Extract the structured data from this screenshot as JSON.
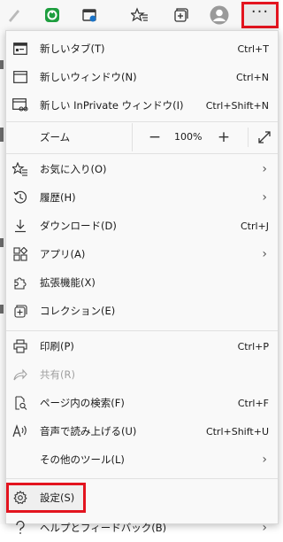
{
  "toolbar": {
    "icons": [
      "pen-icon",
      "extension-green-icon",
      "screen-capture-icon",
      "favorites-icon",
      "collections-icon",
      "profile-avatar-icon",
      "more-icon"
    ],
    "more_label": "···"
  },
  "menu": {
    "new_tab": {
      "label": "新しいタブ(T)",
      "shortcut": "Ctrl+T"
    },
    "new_window": {
      "label": "新しいウィンドウ(N)",
      "shortcut": "Ctrl+N"
    },
    "new_inprivate": {
      "label": "新しい InPrivate ウィンドウ(I)",
      "shortcut": "Ctrl+Shift+N"
    },
    "zoom": {
      "label": "ズーム",
      "minus": "−",
      "value": "100%",
      "plus": "+"
    },
    "favorites": {
      "label": "お気に入り(O)"
    },
    "history": {
      "label": "履歴(H)"
    },
    "downloads": {
      "label": "ダウンロード(D)",
      "shortcut": "Ctrl+J"
    },
    "apps": {
      "label": "アプリ(A)"
    },
    "extensions": {
      "label": "拡張機能(X)"
    },
    "collections": {
      "label": "コレクション(E)"
    },
    "print": {
      "label": "印刷(P)",
      "shortcut": "Ctrl+P"
    },
    "share": {
      "label": "共有(R)"
    },
    "find": {
      "label": "ページ内の検索(F)",
      "shortcut": "Ctrl+F"
    },
    "read_aloud": {
      "label": "音声で読み上げる(U)",
      "shortcut": "Ctrl+Shift+U"
    },
    "more_tools": {
      "label": "その他のツール(L)"
    },
    "settings": {
      "label": "設定(S)"
    },
    "help": {
      "label": "ヘルプとフィードバック(B)"
    }
  },
  "colors": {
    "highlight": "#e3141f",
    "menu_bg": "#f9f9f9"
  }
}
